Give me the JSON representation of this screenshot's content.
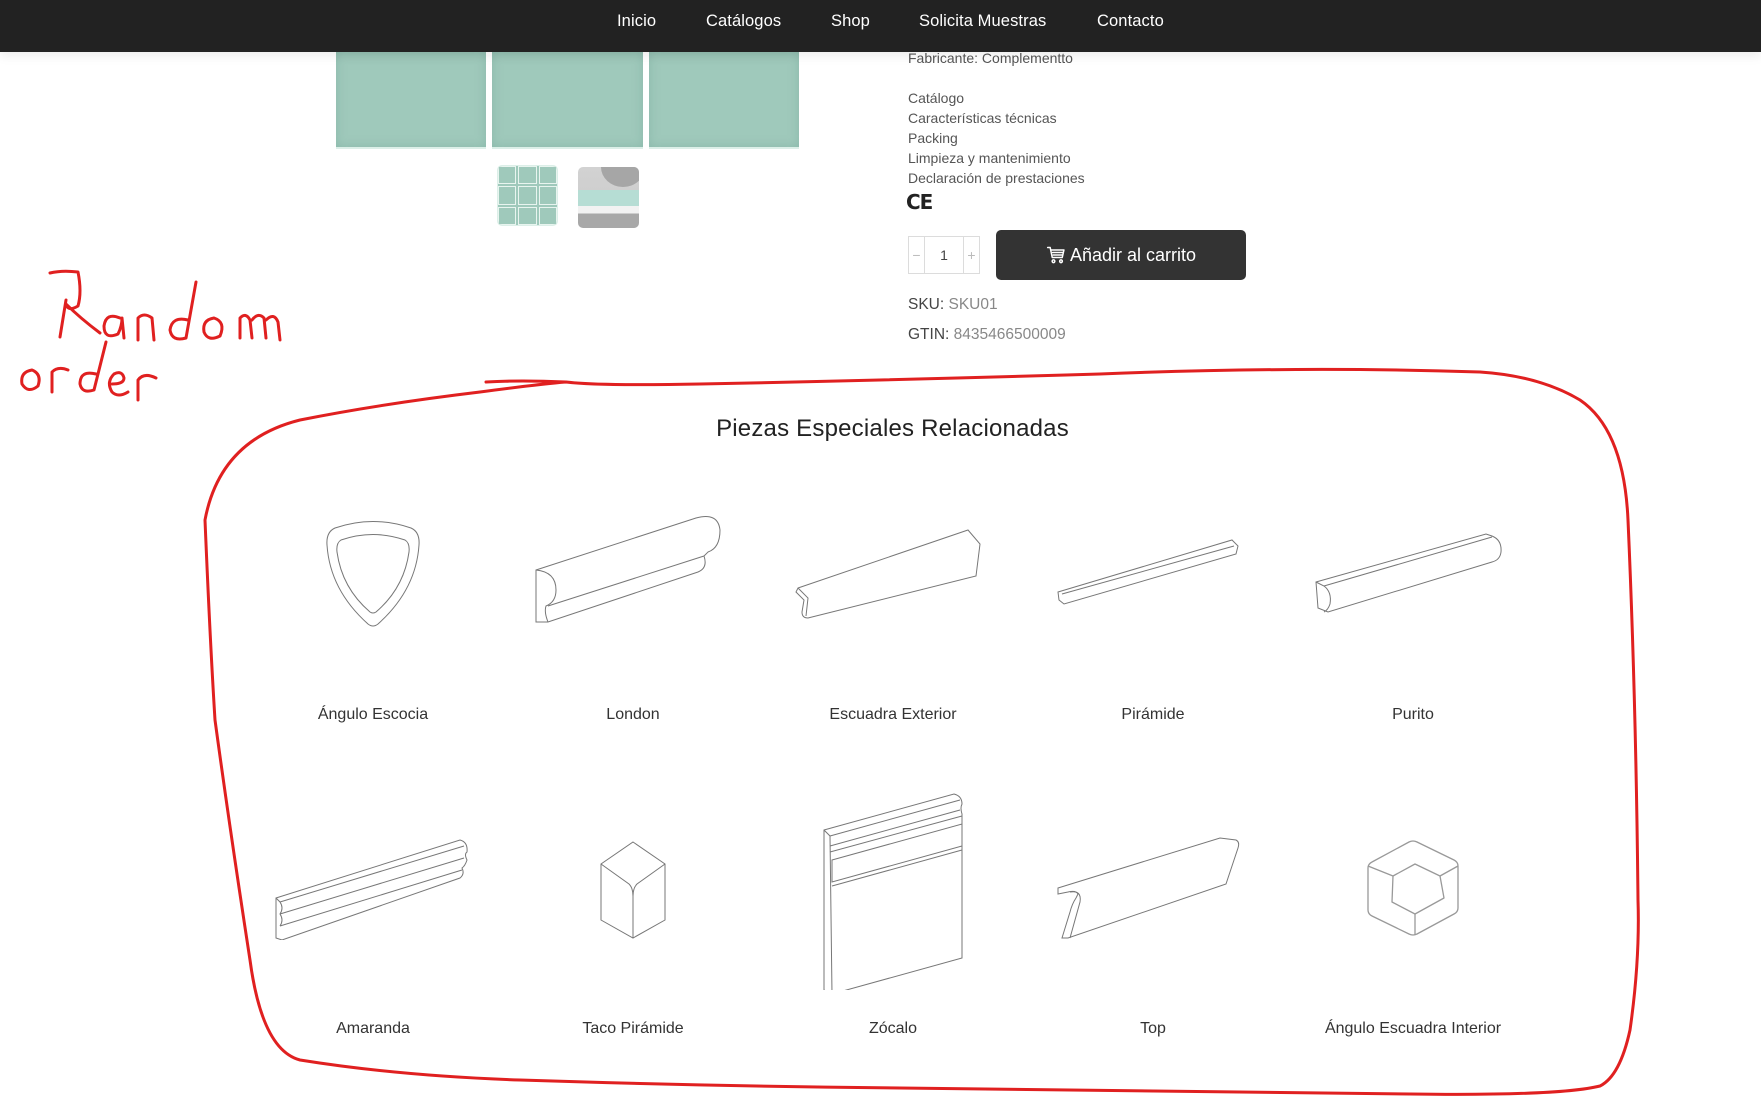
{
  "nav": {
    "items": [
      {
        "label": "Inicio"
      },
      {
        "label": "Catálogos"
      },
      {
        "label": "Shop"
      },
      {
        "label": "Solicita Muestras"
      },
      {
        "label": "Contacto"
      }
    ]
  },
  "product": {
    "manufacturer": "Fabricante: Complementto",
    "documents": [
      "Catálogo",
      "Características técnicas",
      "Packing",
      "Limpieza y mantenimiento",
      "Declaración de prestaciones"
    ],
    "ce_mark": "CE",
    "quantity": "1",
    "qty_minus": "−",
    "qty_plus": "+",
    "add_to_cart_label": "Añadir al carrito",
    "sku_label": "SKU:",
    "sku_value": "SKU01",
    "gtin_label": "GTIN:",
    "gtin_value": "8435466500009",
    "colors": {
      "tile": "#9fc9bb",
      "button": "#333333",
      "nav": "#222222"
    }
  },
  "annotation": {
    "text_line1": "Random",
    "text_line2": "order",
    "color": "#e02020"
  },
  "related": {
    "title": "Piezas Especiales Relacionadas",
    "items": [
      {
        "label": "Ángulo Escocia",
        "icon": "angulo-escocia-icon"
      },
      {
        "label": "London",
        "icon": "london-icon"
      },
      {
        "label": "Escuadra Exterior",
        "icon": "escuadra-exterior-icon"
      },
      {
        "label": "Pirámide",
        "icon": "piramide-icon"
      },
      {
        "label": "Purito",
        "icon": "purito-icon"
      },
      {
        "label": "Amaranda",
        "icon": "amaranda-icon"
      },
      {
        "label": "Taco Pirámide",
        "icon": "taco-piramide-icon"
      },
      {
        "label": "Zócalo",
        "icon": "zocalo-icon"
      },
      {
        "label": "Top",
        "icon": "top-icon"
      },
      {
        "label": "Ángulo Escuadra Interior",
        "icon": "angulo-escuadra-interior-icon"
      }
    ]
  }
}
